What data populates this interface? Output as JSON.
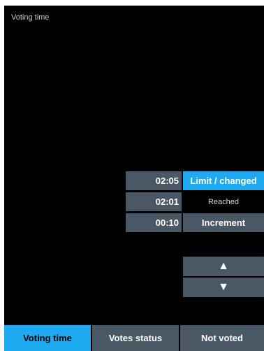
{
  "panel": {
    "title": "Voting time"
  },
  "rows": [
    {
      "time": "02:05",
      "label": "Limit / changed"
    },
    {
      "time": "02:01",
      "label": "Reached"
    },
    {
      "time": "00:10",
      "label": "Increment"
    }
  ],
  "controls": {
    "up_glyph": "▲",
    "down_glyph": "▼"
  },
  "tabs": [
    {
      "label": "Voting time",
      "active": true
    },
    {
      "label": "Votes status",
      "active": false
    },
    {
      "label": "Not voted",
      "active": false
    }
  ],
  "colors": {
    "accent": "#1eaaf0",
    "button": "#4a5866",
    "background": "#000000"
  }
}
